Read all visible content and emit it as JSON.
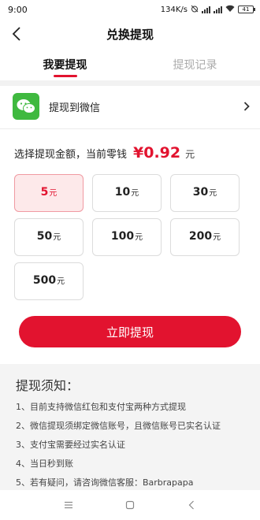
{
  "status_bar": {
    "time": "9:00",
    "network_speed": "134K/s",
    "battery": "41",
    "icons": [
      "alarm-off-icon",
      "signal-icon",
      "signal-icon",
      "wifi-icon",
      "battery-icon"
    ]
  },
  "header": {
    "title": "兑换提现",
    "back_icon": "chevron-left-icon"
  },
  "tabs": [
    {
      "label": "我要提现",
      "active": true
    },
    {
      "label": "提现记录",
      "active": false
    }
  ],
  "method": {
    "label": "提现到微信",
    "icon": "wechat-icon",
    "chevron_icon": "chevron-right-icon"
  },
  "amount": {
    "prompt": "选择提现金额，当前零钱",
    "value": "¥0.92",
    "unit": "元"
  },
  "options": [
    {
      "num": "5",
      "unit": "元",
      "selected": true
    },
    {
      "num": "10",
      "unit": "元",
      "selected": false
    },
    {
      "num": "30",
      "unit": "元",
      "selected": false
    },
    {
      "num": "50",
      "unit": "元",
      "selected": false
    },
    {
      "num": "100",
      "unit": "元",
      "selected": false
    },
    {
      "num": "200",
      "unit": "元",
      "selected": false
    },
    {
      "num": "500",
      "unit": "元",
      "selected": false
    }
  ],
  "submit": {
    "label": "立即提现"
  },
  "notice": {
    "title": "提现须知：",
    "items": [
      "1、目前支持微信红包和支付宝两种方式提现",
      "2、微信提现须绑定微信账号，且微信账号已实名认证",
      "3、支付宝需要经过实名认证",
      "4、当日秒到账",
      "5、若有疑问，请咨询微信客服：Barbrapapa"
    ]
  },
  "nav_bar": {
    "icons": [
      "menu-icon",
      "home-icon",
      "back-icon"
    ]
  },
  "colors": {
    "accent": "#e2132f",
    "wechat_green": "#3fb93f",
    "selected_bg": "#fde9ea",
    "notice_bg": "#f4f4f4"
  }
}
